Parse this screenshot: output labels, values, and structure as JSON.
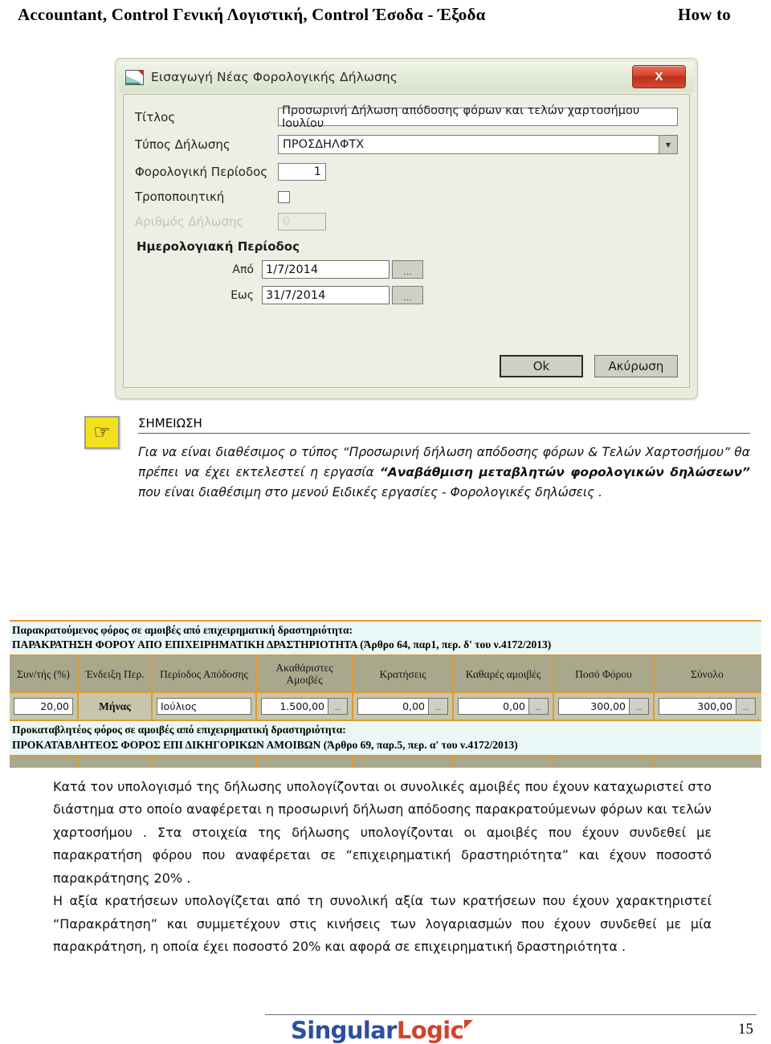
{
  "header": {
    "left": "Accountant,  Control Γενική Λογιστική,   Control Έσοδα - Έξοδα",
    "right": "How to"
  },
  "dialog": {
    "title": "Εισαγωγή Νέας Φορολογικής Δήλωσης",
    "close_label": "X",
    "fields": {
      "title_label": "Τίτλος",
      "title_value": "Προσωρινή Δήλωση απόδοσης φόρων και τελών χαρτοσήμου Ιουλίου",
      "type_label": "Τύπος Δήλωσης",
      "type_value": "ΠΡΟΣΔΗΛΦΤΧ",
      "period_label": "Φορολογική Περίοδος",
      "period_value": "1",
      "amending_label": "Τροποποιητική",
      "declaration_number_label": "Αριθμός Δήλωσης",
      "declaration_number_value": "0"
    },
    "calendar_group": {
      "title": "Ημερολογιακή Περίοδος",
      "from_label": "Από",
      "from_value": "1/7/2014",
      "to_label": "Εως",
      "to_value": "31/7/2014",
      "browse_label": "..."
    },
    "buttons": {
      "ok": "Ok",
      "cancel": "Ακύρωση"
    }
  },
  "note": {
    "icon": "pointing-hand-icon",
    "title": "ΣΗΜΕΙΩΣΗ",
    "text_part1": "Για να είναι διαθέσιμος ο τύπος “Προσωρινή δήλωση απόδοσης φόρων & Τελών Χαρτοσήμου” θα πρέπει να έχει εκτελεστεί η εργασία ",
    "text_bold": "“Αναβάθμιση μεταβλητών φορολογικών δηλώσεων”",
    "text_part2": " που είναι διαθέσιμη στο μενού Ειδικές εργασίες - Φορολογικές δηλώσεις ."
  },
  "table": {
    "band1_line1": "Παρακρατούμενος φόρος σε αμοιβές από επιχειρηματική δραστηριότητα:",
    "band1_line2": "ΠΑΡΑΚΡΑΤΗΣΗ ΦΟΡΟΥ ΑΠΟ ΕΠΙΧΕΙΡΗΜΑΤΙΚΗ ΔΡΑΣΤΗΡΙΟΤΗΤΑ (Άρθρο 64, παρ1, περ. δ' του ν.4172/2013)",
    "columns": [
      "Συν/τής (%)",
      "Ένδειξη Περ.",
      "Περίοδος Απόδοσης",
      "Ακαθάριστες Αμοιβές",
      "Κρατήσεις",
      "Καθαρές αμοιβές",
      "Ποσό Φόρου",
      "Σύνολο"
    ],
    "row": {
      "rate": "20,00",
      "period_indication": "Μήνας",
      "period": "Ιούλιος",
      "gross_fees": "1.500,00",
      "withholdings": "0,00",
      "net_fees": "0,00",
      "tax_amount": "300,00",
      "total": "300,00",
      "browse_label": "..."
    },
    "band2_line1": "Προκαταβλητέος φόρος σε αμοιβές από επιχειρηματική δραστηριότητα:",
    "band2_line2": "ΠΡΟΚΑΤΑΒΛΗΤΕΟΣ ΦΟΡΟΣ ΕΠΙ ΔΙΚΗΓΟΡΙΚΩΝ ΑΜΟΙΒΩΝ (Άρθρο 69, παρ.5, περ. α' του ν.4172/2013)"
  },
  "body": {
    "p1": "Κατά τον υπολογισμό της δήλωσης υπολογίζονται οι συνολικές αμοιβές που έχουν καταχωριστεί στο διάστημα στο οποίο αναφέρεται η προσωρινή δήλωση απόδοσης παρακρατούμενων φόρων και τελών χαρτοσήμου . Στα στοιχεία της δήλωσης υπολογίζονται οι αμοιβές που έχουν συνδεθεί με παρακρατήση φόρου που αναφέρεται σε “επιχειρηματική δραστηριότητα” και έχουν ποσοστό παρακράτησης 20% .",
    "p2": "Η αξία κρατήσεων υπολογίζεται από τη συνολική αξία των κρατήσεων που έχουν χαρακτηριστεί “Παρακράτηση” και συμμετέχουν στις κινήσεις των λογαριασμών που έχουν συνδεθεί με μία παρακράτηση, η οποία έχει ποσοστό 20% και αφορά σε επιχειρηματική δραστηριότητα ."
  },
  "footer": {
    "logo_part1": "Singular",
    "logo_part2": "Logic",
    "page_number": "15"
  },
  "colors": {
    "accent_orange": "#e09a2e",
    "header_olive": "#a9a88c",
    "row_olive": "#c7c6ab",
    "band_cyan": "#eaf7f7",
    "logo_blue": "#2c4f9e",
    "logo_red": "#d1432c",
    "note_yellow": "#f2e11e"
  }
}
